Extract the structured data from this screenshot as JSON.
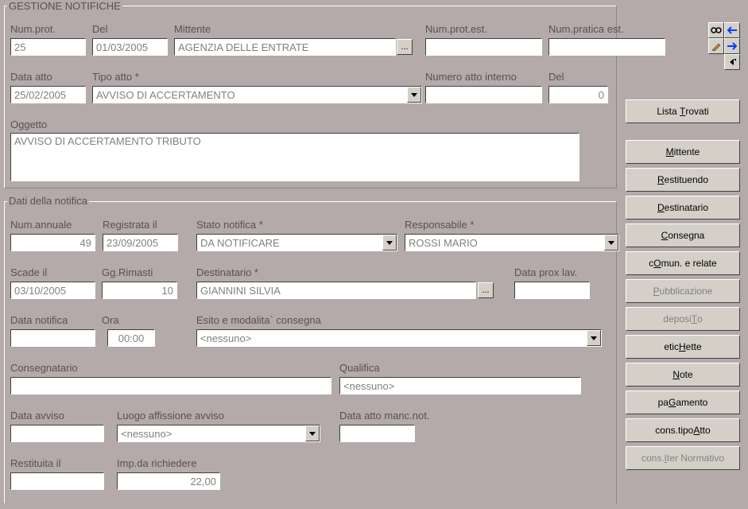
{
  "group1": {
    "legend": "GESTIONE NOTIFICHE"
  },
  "top": {
    "numprot_label": "Num.prot.",
    "numprot": "25",
    "del_label": "Del",
    "del": "01/03/2005",
    "mittente_label": "Mittente",
    "mittente": "AGENZIA DELLE ENTRATE",
    "numprotest_label": "Num.prot.est.",
    "numprotest": "",
    "numpratica_label": "Num.pratica est.",
    "numpratica": "",
    "dataatto_label": "Data atto",
    "dataatto": "25/02/2005",
    "tipoatto_label": "Tipo atto *",
    "tipoatto": "AVVISO DI ACCERTAMENTO",
    "numattoint_label": "Numero atto interno",
    "numattoint": "",
    "del2_label": "Del",
    "del2": "0",
    "oggetto_label": "Oggetto",
    "oggetto": "AVVISO DI ACCERTAMENTO TRIBUTO"
  },
  "group2": {
    "legend": "Dati della notifica"
  },
  "notif": {
    "numannuale_label": "Num.annuale",
    "numannuale": "49",
    "registrata_label": "Registrata il",
    "registrata": "23/09/2005",
    "stato_label": "Stato notifica *",
    "stato": "DA NOTIFICARE",
    "responsabile_label": "Responsabile *",
    "responsabile": "ROSSI MARIO",
    "scade_label": "Scade il",
    "scade": "03/10/2005",
    "ggrimasti_label": "Gg.Rimasti",
    "ggrimasti": "10",
    "destinatario_label": "Destinatario *",
    "destinatario": "GIANNINI SILVIA",
    "dataprox_label": "Data prox lav.",
    "dataprox": "",
    "datanotifica_label": "Data notifica",
    "datanotifica": "",
    "ora_label": "Ora",
    "ora": "00:00",
    "esito_label": "Esito e modalita` consegna",
    "esito": "<nessuno>",
    "consegnatario_label": "Consegnatario",
    "consegnatario": "",
    "qualifica_label": "Qualifica",
    "qualifica": "<nessuno>",
    "dataavviso_label": "Data avviso",
    "dataavviso": "",
    "luogo_label": "Luogo affissione avviso",
    "luogo": "<nessuno>",
    "datamanc_label": "Data atto manc.not.",
    "datamanc": "",
    "restituita_label": "Restituita il",
    "restituita": "",
    "imp_label": "Imp.da richiedere",
    "imp": "22,00"
  },
  "side": {
    "lista": "Lista Trovati",
    "mittente": "Mittente",
    "restituendo": "Restituendo",
    "destinatario": "Destinatario",
    "consegna": "Consegna",
    "comun": "cOmun. e relate",
    "pubblicazione": "Pubblicazione",
    "deposito": "depsiTo",
    "deposito_txt1": "deposi",
    "deposito_txt2": "o",
    "etichette1": "etic",
    "etichette2": "ette",
    "note1": "ote",
    "pagamento1": "pa",
    "pagamento2": "amento",
    "constipo1": "cons.tipo ",
    "constipo2": "tto",
    "consiter": "cons.Iter Normativo"
  }
}
